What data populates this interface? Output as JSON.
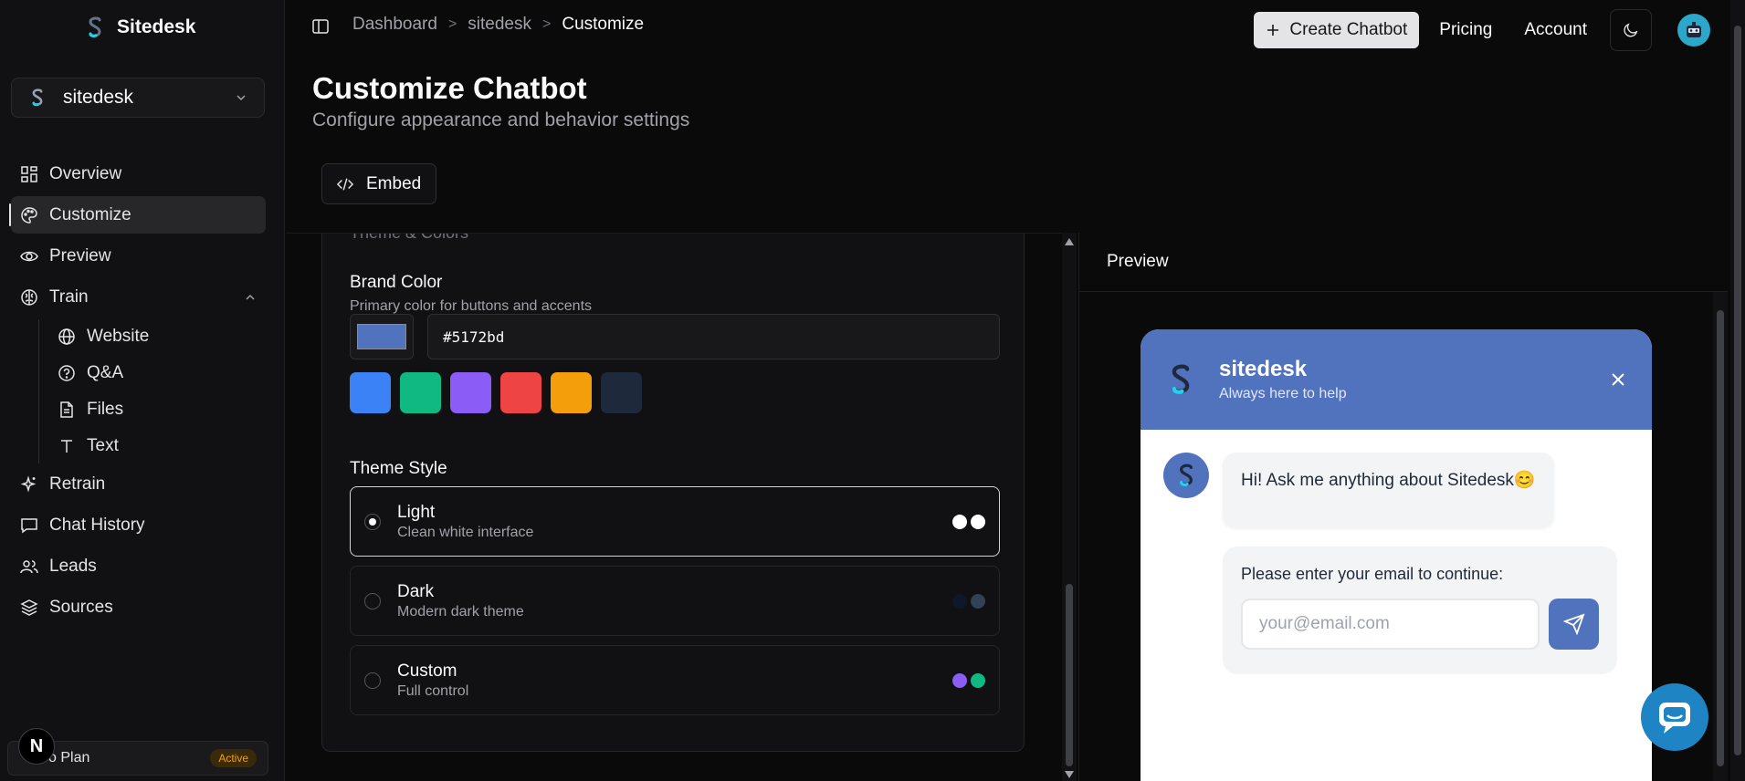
{
  "app": {
    "name": "Sitedesk",
    "workspace": "sitedesk"
  },
  "sidebar": {
    "items": [
      {
        "label": "Overview",
        "icon": "grid-icon"
      },
      {
        "label": "Customize",
        "icon": "palette-icon",
        "active": true
      },
      {
        "label": "Preview",
        "icon": "eye-icon"
      },
      {
        "label": "Train",
        "icon": "brain-icon",
        "expanded": true
      }
    ],
    "train_children": [
      {
        "label": "Website",
        "icon": "globe-icon"
      },
      {
        "label": "Q&A",
        "icon": "help-circle-icon"
      },
      {
        "label": "Files",
        "icon": "file-icon"
      },
      {
        "label": "Text",
        "icon": "text-icon"
      }
    ],
    "bottom_items": [
      {
        "label": "Retrain",
        "icon": "sparkles-icon"
      },
      {
        "label": "Chat History",
        "icon": "message-square-icon"
      },
      {
        "label": "Leads",
        "icon": "users-icon"
      },
      {
        "label": "Sources",
        "icon": "layers-icon"
      }
    ],
    "plan_label": "o Plan",
    "plan_badge": "Active",
    "dev_badge": "N"
  },
  "header": {
    "breadcrumbs": [
      "Dashboard",
      "sitedesk",
      "Customize"
    ],
    "create_label": "Create Chatbot",
    "pricing_label": "Pricing",
    "account_label": "Account"
  },
  "page": {
    "title": "Customize Chatbot",
    "subtitle": "Configure appearance and behavior settings",
    "embed_label": "Embed"
  },
  "settings": {
    "section_title": "Theme & Colors",
    "brand_color_label": "Brand Color",
    "brand_color_help": "Primary color for buttons and accents",
    "brand_color_value": "#5172bd",
    "presets": [
      "#3b82f6",
      "#10b981",
      "#8b5cf6",
      "#ef4444",
      "#f59e0b",
      "#1e293b"
    ],
    "theme_style_label": "Theme Style",
    "themes": [
      {
        "title": "Light",
        "desc": "Clean white interface",
        "selected": true,
        "dots": [
          "#ffffff",
          "#ffffff"
        ]
      },
      {
        "title": "Dark",
        "desc": "Modern dark theme",
        "selected": false,
        "dots": [
          "#0f172a",
          "#334155"
        ]
      },
      {
        "title": "Custom",
        "desc": "Full control",
        "selected": false,
        "dots": [
          "#8b5cf6",
          "#10b981"
        ]
      }
    ]
  },
  "preview": {
    "header": "Preview",
    "bot_name": "sitedesk",
    "bot_tagline": "Always here to help",
    "greeting": "Hi! Ask me anything about Sitedesk😊",
    "email_prompt": "Please enter your email to continue:",
    "email_placeholder": "your@email.com"
  },
  "colors": {
    "brand": "#5172bd",
    "background": "#0a0a0b",
    "sidebar": "#111113"
  }
}
